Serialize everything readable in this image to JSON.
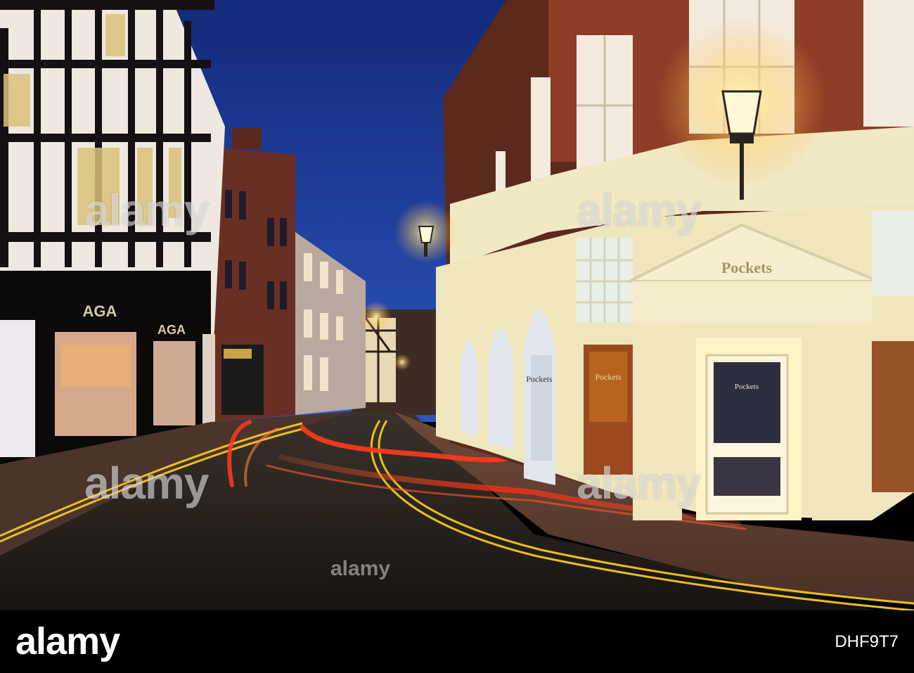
{
  "scene": {
    "shop_signs": {
      "pockets_pediment": "Pockets",
      "pockets_door": "Pockets",
      "pockets_window_1": "Pockets",
      "pockets_window_2": "Pockets",
      "aga_fascia_1": "AGA",
      "aga_fascia_2": "AGA"
    }
  },
  "watermark": {
    "text": "alamy",
    "small_text": "alamy"
  },
  "footer": {
    "logo": "alamy",
    "image_id": "DHF9T7"
  },
  "colors": {
    "sky": "#1c3d9a",
    "light_trail": "#ff3b1e",
    "road_line": "#e8c020",
    "facade_lit": "#f1e8c4"
  }
}
